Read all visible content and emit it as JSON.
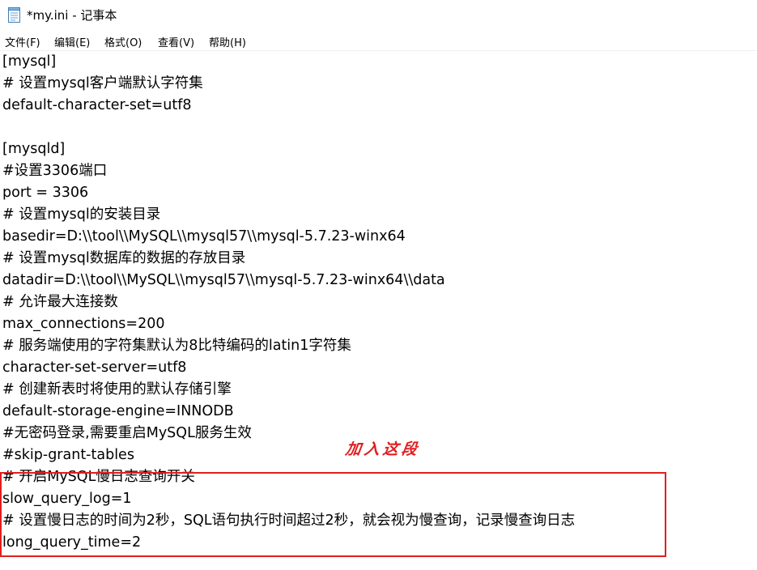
{
  "window": {
    "title": "*my.ini - 记事本",
    "icon": "notepad-icon"
  },
  "menu": {
    "file": "文件(F)",
    "edit": "编辑(E)",
    "format": "格式(O)",
    "view": "查看(V)",
    "help": "帮助(H)"
  },
  "editor": {
    "lines": [
      "[mysql]",
      "# 设置mysql客户端默认字符集",
      "default-character-set=utf8",
      "",
      "[mysqld]",
      "#设置3306端口",
      "port = 3306",
      "# 设置mysql的安装目录",
      "basedir=D:\\\\tool\\\\MySQL\\\\mysql57\\\\mysql-5.7.23-winx64",
      "# 设置mysql数据库的数据的存放目录",
      "datadir=D:\\\\tool\\\\MySQL\\\\mysql57\\\\mysql-5.7.23-winx64\\\\data",
      "# 允许最大连接数",
      "max_connections=200",
      "# 服务端使用的字符集默认为8比特编码的latin1字符集",
      "character-set-server=utf8",
      "# 创建新表时将使用的默认存储引擎",
      "default-storage-engine=INNODB",
      "#无密码登录,需要重启MySQL服务生效",
      "#skip-grant-tables",
      "# 开启MySQL慢日志查询开关",
      "slow_query_log=1",
      "# 设置慢日志的时间为2秒，SQL语句执行时间超过2秒，就会视为慢查询，记录慢查询日志",
      "long_query_time=2"
    ]
  },
  "annotation": {
    "text": "加入这段",
    "color": "#e01e1e"
  },
  "colors": {
    "highlight_border": "#e01e1e",
    "text": "#000000",
    "background": "#ffffff"
  }
}
